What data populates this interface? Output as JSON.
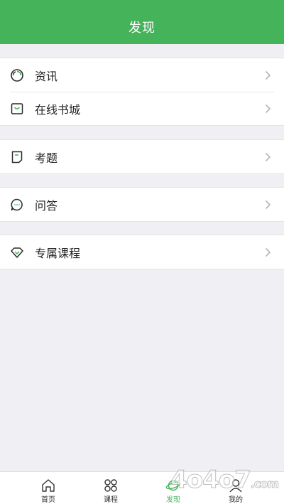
{
  "header": {
    "title": "发现"
  },
  "groups": [
    {
      "items": [
        {
          "label": "资讯",
          "icon": "news-ring-icon"
        },
        {
          "label": "在线书城",
          "icon": "shopping-bag-icon"
        }
      ]
    },
    {
      "items": [
        {
          "label": "考题",
          "icon": "exam-paper-icon"
        }
      ]
    },
    {
      "items": [
        {
          "label": "问答",
          "icon": "chat-bubble-icon"
        }
      ]
    },
    {
      "items": [
        {
          "label": "专属课程",
          "icon": "gem-icon"
        }
      ]
    }
  ],
  "tabbar": {
    "tabs": [
      {
        "label": "首页",
        "icon": "home-icon"
      },
      {
        "label": "课程",
        "icon": "course-grid-icon"
      },
      {
        "label": "发现",
        "icon": "planet-icon",
        "active": true
      },
      {
        "label": "我的",
        "icon": "profile-icon"
      }
    ]
  },
  "watermark": {
    "text": "4o4o7",
    "suffix": ".com"
  },
  "colors": {
    "accent": "#45b35a",
    "background": "#efeff4"
  }
}
